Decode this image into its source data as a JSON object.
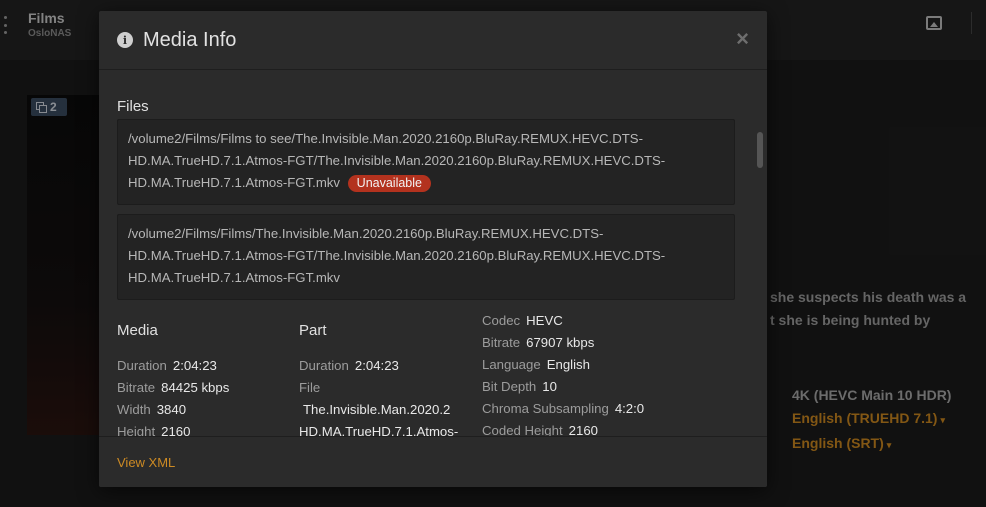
{
  "app": {
    "library_title": "Films",
    "server_name": "OsloNAS",
    "poster_badge_count": "2",
    "summary_lines": [
      "she suspects his death was a",
      "t she is being hunted by"
    ],
    "video_stream": "4K (HEVC Main 10 HDR)",
    "audio_stream": "English (TRUEHD 7.1)",
    "subtitle_stream": "English (SRT)",
    "caret": "▾"
  },
  "modal": {
    "title": "Media Info",
    "info_glyph": "i",
    "close_glyph": "×",
    "files_heading": "Files",
    "files": [
      {
        "path": "/volume2/Films/Films to see/The.Invisible.Man.2020.2160p.BluRay.REMUX.HEVC.DTS-HD.MA.TrueHD.7.1.Atmos-FGT/The.Invisible.Man.2020.2160p.BluRay.REMUX.HEVC.DTS-HD.MA.TrueHD.7.1.Atmos-FGT.mkv",
        "status": "Unavailable"
      },
      {
        "path": "/volume2/Films/Films/The.Invisible.Man.2020.2160p.BluRay.REMUX.HEVC.DTS-HD.MA.TrueHD.7.1.Atmos-FGT/The.Invisible.Man.2020.2160p.BluRay.REMUX.HEVC.DTS-HD.MA.TrueHD.7.1.Atmos-FGT.mkv"
      }
    ],
    "media": {
      "heading": "Media",
      "rows": [
        {
          "k": "Duration",
          "v": "2:04:23"
        },
        {
          "k": "Bitrate",
          "v": "84425 kbps"
        },
        {
          "k": "Width",
          "v": "3840"
        },
        {
          "k": "Height",
          "v": "2160"
        }
      ]
    },
    "part": {
      "heading": "Part",
      "duration_label": "Duration",
      "duration_value": "2:04:23",
      "file_label": "File",
      "file_value_line1": "The.Invisible.Man.2020.2",
      "file_value_line2": "HD.MA.TrueHD.7.1.Atmos-"
    },
    "stream": {
      "rows": [
        {
          "k": "Codec",
          "v": "HEVC"
        },
        {
          "k": "Bitrate",
          "v": "67907 kbps"
        },
        {
          "k": "Language",
          "v": "English"
        },
        {
          "k": "Bit Depth",
          "v": "10"
        },
        {
          "k": "Chroma Subsampling",
          "v": "4:2:0"
        },
        {
          "k": "Coded Height",
          "v": "2160"
        }
      ]
    },
    "footer_link": "View XML"
  },
  "colors": {
    "accent": "#cc8a24",
    "unavailable_badge": "#b3321e",
    "modal_bg": "#2b2b2b"
  }
}
